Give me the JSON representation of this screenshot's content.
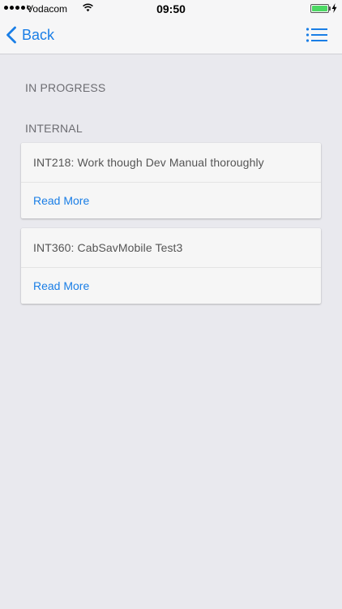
{
  "status_bar": {
    "signal_bars_filled": 4,
    "signal_bars_total": 5,
    "carrier": "Vodacom",
    "time": "09:50",
    "battery_level": 1.0,
    "battery_color": "#4cd964"
  },
  "nav": {
    "back_label": "Back",
    "accent_color": "#1a7ee6",
    "right_icon": "list-menu-icon"
  },
  "sections": [
    {
      "header": "IN PROGRESS",
      "items": []
    },
    {
      "header": "INTERNAL",
      "items": [
        {
          "title": "INT218: Work though Dev Manual thoroughly",
          "action": "Read More"
        },
        {
          "title": "INT360: CabSavMobile Test3",
          "action": "Read More"
        }
      ]
    }
  ]
}
